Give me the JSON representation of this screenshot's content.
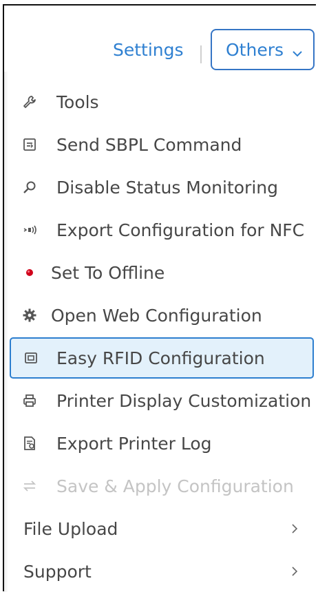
{
  "header": {
    "settings_label": "Settings",
    "others_label": "Others"
  },
  "menu": {
    "items": [
      {
        "label": "Tools",
        "icon": "wrench-icon"
      },
      {
        "label": "Send SBPL Command",
        "icon": "command-icon"
      },
      {
        "label": "Disable Status Monitoring",
        "icon": "search-icon"
      },
      {
        "label": "Export Configuration for NFC",
        "icon": "nfc-icon"
      },
      {
        "label": "Set To Offline",
        "icon": "red-dot-icon",
        "status_color": "#d0021b"
      },
      {
        "label": "Open Web Configuration",
        "icon": "gear-icon"
      },
      {
        "label": "Easy RFID Configuration",
        "icon": "rfid-icon",
        "selected": true
      },
      {
        "label": "Printer Display Customization",
        "icon": "printer-icon"
      },
      {
        "label": "Export Printer Log",
        "icon": "log-icon"
      },
      {
        "label": "Save & Apply Configuration",
        "icon": "sync-icon",
        "disabled": true
      },
      {
        "label": "File Upload",
        "has_submenu": true
      },
      {
        "label": "Support",
        "has_submenu": true
      }
    ]
  },
  "colors": {
    "accent": "#2f80d1",
    "selected_bg": "#e3f1fb",
    "selected_border": "#2c7ecf",
    "text": "#474747",
    "disabled_text": "#c4c4c4"
  }
}
